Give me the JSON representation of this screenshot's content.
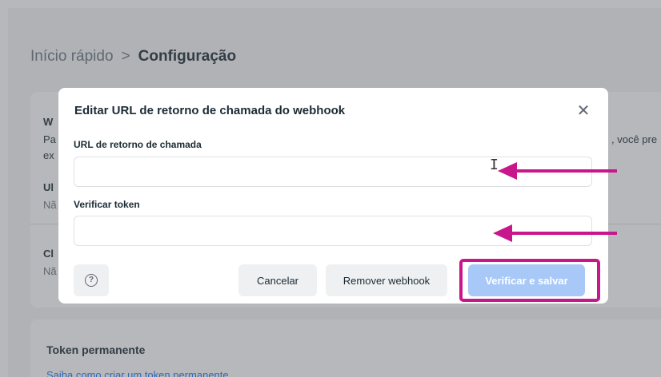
{
  "breadcrumb": {
    "parent": "Início rápido",
    "separator": ">",
    "current": "Configuração"
  },
  "background": {
    "card1_heading": "W",
    "card1_desc": "Pa",
    "card1_desc2": "ex",
    "card1_right_text": ", você pre",
    "field1_label": "Ul",
    "field1_value": "Nã",
    "field2_label": "Cl",
    "field2_value": "Nã",
    "card2_title": "Token permanente",
    "card2_link": "Saiba como criar um token permanente"
  },
  "modal": {
    "title": "Editar URL de retorno de chamada do webhook",
    "close_symbol": "✕",
    "callback_label": "URL de retorno de chamada",
    "callback_value": "",
    "callback_placeholder": "",
    "token_label": "Verificar token",
    "token_value": "",
    "token_placeholder": "",
    "help_symbol": "?",
    "cancel_label": "Cancelar",
    "remove_label": "Remover webhook",
    "save_label": "Verificar e salvar"
  },
  "icons": {
    "close": "close-icon",
    "help": "question-circle-icon",
    "cursor": "text-cursor-icon",
    "arrows": "annotation-arrow-icon"
  },
  "colors": {
    "primary_disabled": "#a8c8f8",
    "annotation": "#c8168c",
    "link": "#1877f2"
  }
}
